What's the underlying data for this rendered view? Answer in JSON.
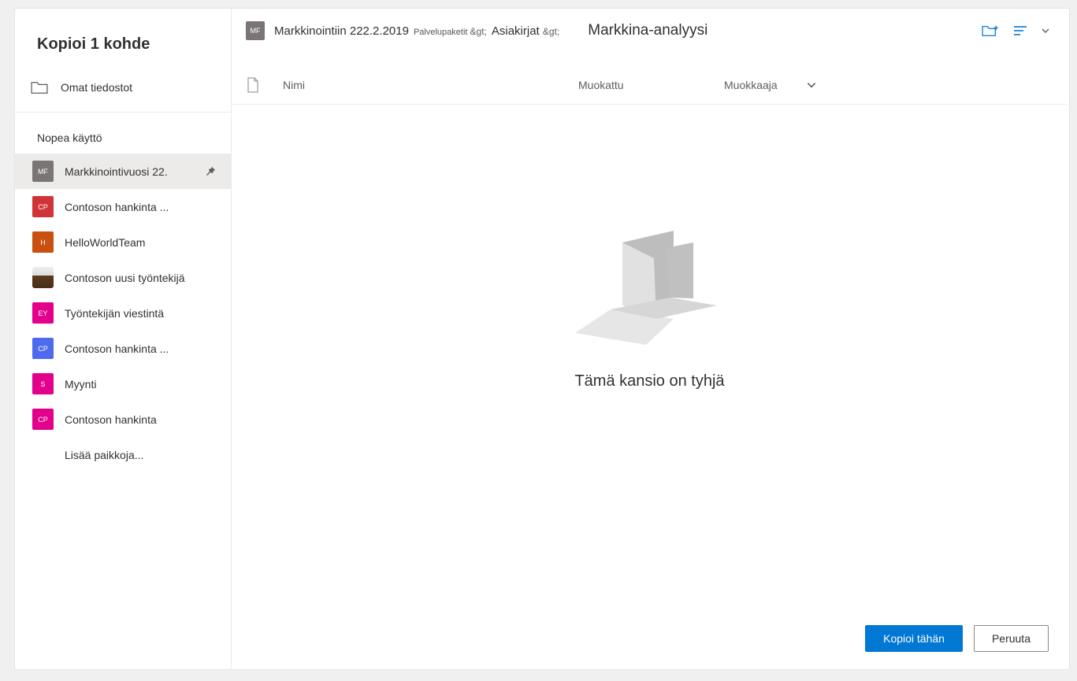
{
  "dialog_title": "Kopioi 1 kohde",
  "own_files": "Omat tiedostot",
  "quick_access_label": "Nopea käyttö",
  "quick_access": [
    {
      "label": "Markkinointivuosi 22.",
      "initials": "MF",
      "color": "#7a7574",
      "selected": true,
      "pinned": true
    },
    {
      "label": "Contoson hankinta ...",
      "initials": "CP",
      "color": "#d13438",
      "selected": false,
      "pinned": false
    },
    {
      "label": "HelloWorldTeam",
      "initials": "H",
      "color": "#ca5010",
      "selected": false,
      "pinned": false
    },
    {
      "label": "Contoson uusi työntekijä",
      "initials": "",
      "color": "coffee",
      "selected": false,
      "pinned": false
    },
    {
      "label": "Työntekijän viestintä",
      "initials": "EY",
      "color": "#e3008c",
      "selected": false,
      "pinned": false
    },
    {
      "label": "Contoson hankinta ...",
      "initials": "CP",
      "color": "#4f6bed",
      "selected": false,
      "pinned": false
    },
    {
      "label": "Myynti",
      "initials": "S",
      "color": "#e3008c",
      "selected": false,
      "pinned": false
    },
    {
      "label": "Contoson hankinta",
      "initials": "CP",
      "color": "#e3008c",
      "selected": false,
      "pinned": false
    }
  ],
  "more_places": "Lisää paikkoja...",
  "breadcrumb": {
    "initials": "MF",
    "site": "Markkinointiin 222.2.2019",
    "level1": "Palvelupaketit",
    "level2": "Asiakirjat",
    "current": "Markkina-analyysi",
    "sep": "&gt;"
  },
  "columns": {
    "name": "Nimi",
    "modified": "Muokattu",
    "editor": "Muokkaaja"
  },
  "empty_message": "Tämä kansio on tyhjä",
  "buttons": {
    "copy": "Kopioi tähän",
    "cancel": "Peruuta"
  }
}
